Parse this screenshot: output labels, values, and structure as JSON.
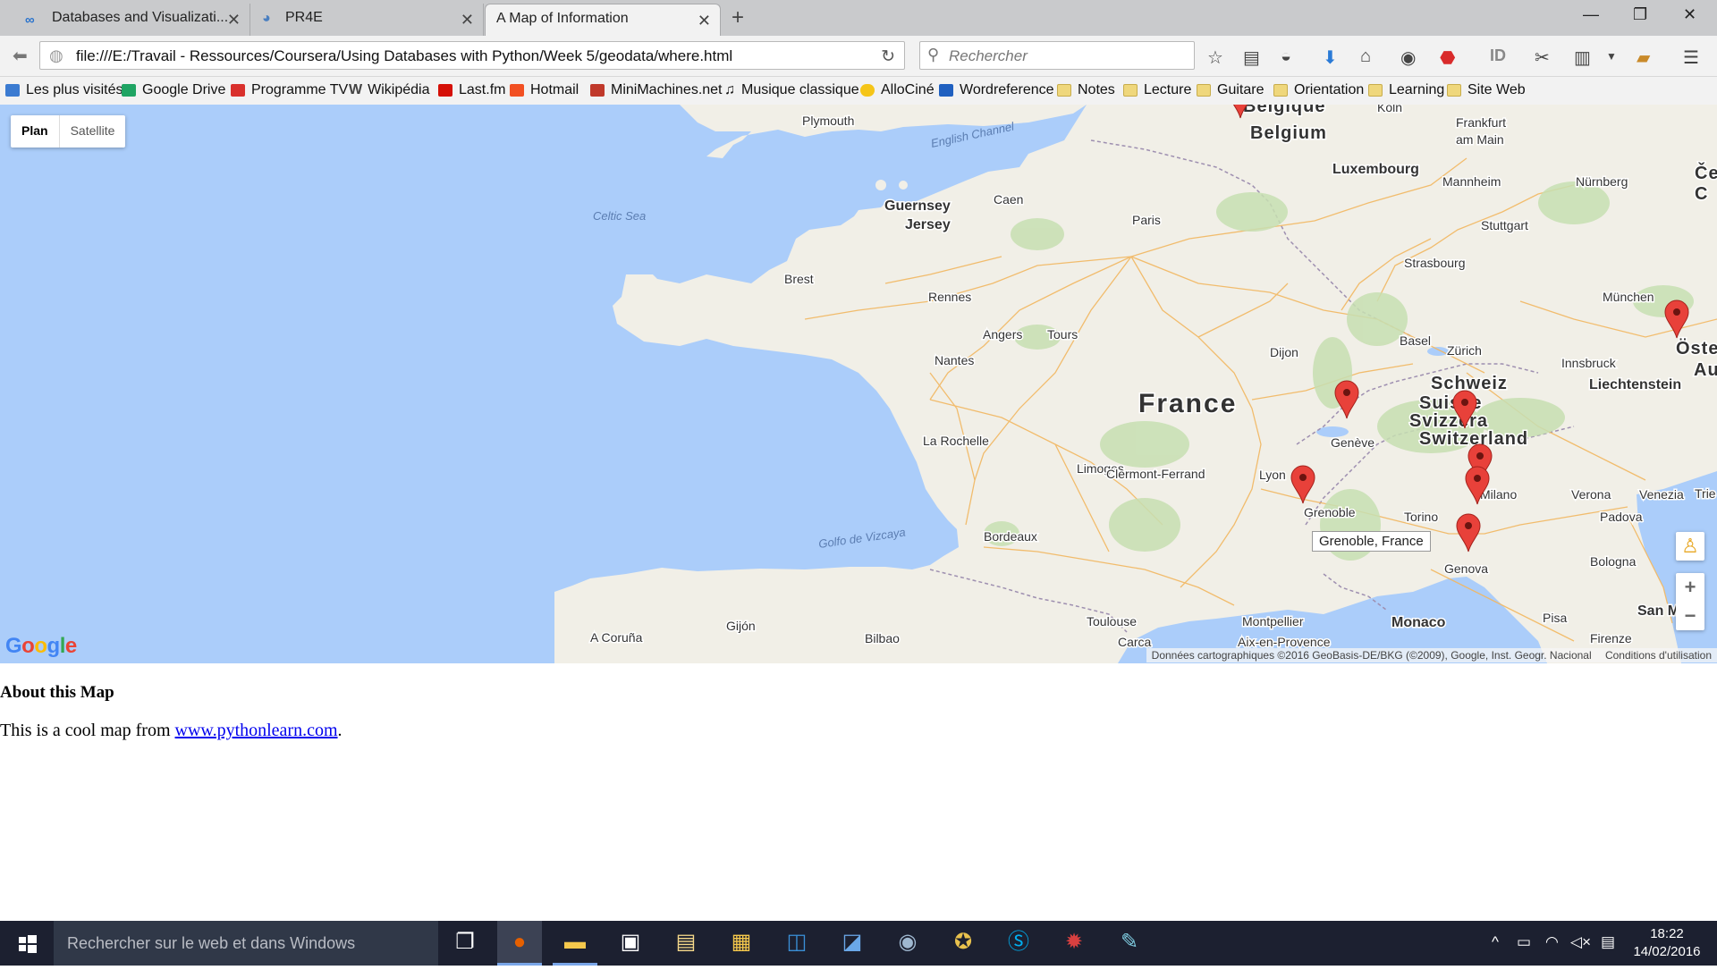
{
  "tabs": [
    {
      "title": "Databases and Visualizati...",
      "icon": "coursera-icon"
    },
    {
      "title": "PR4E",
      "icon": "pr4e-icon"
    },
    {
      "title": "A Map of Information",
      "active": true
    }
  ],
  "navbar": {
    "url": "file:///E:/Travail - Ressources/Coursera/Using Databases with Python/Week 5/geodata/where.html",
    "search_placeholder": "Rechercher"
  },
  "bookmarks": [
    {
      "label": "Les plus visités",
      "icon": "most-visited-icon",
      "color": "#3b7bd1"
    },
    {
      "label": "Google Drive",
      "icon": "google-drive-icon",
      "color": "#1fa463"
    },
    {
      "label": "Programme TV",
      "icon": "programme-tv-icon",
      "color": "#d9302c"
    },
    {
      "label": "Wikipédia",
      "icon": "wikipedia-icon",
      "color": "#555555"
    },
    {
      "label": "Last.fm",
      "icon": "lastfm-icon",
      "color": "#d51007"
    },
    {
      "label": "Hotmail",
      "icon": "hotmail-icon",
      "color": "#f25022"
    },
    {
      "label": "MiniMachines.net",
      "icon": "minimachines-icon",
      "color": "#c0392b"
    },
    {
      "label": "Musique classique",
      "icon": "music-note-icon",
      "color": "#333333"
    },
    {
      "label": "AlloCiné",
      "icon": "allocine-icon",
      "color": "#f5c518"
    },
    {
      "label": "Wordreference",
      "icon": "wordreference-icon",
      "color": "#2060c0"
    },
    {
      "label": "Notes",
      "icon": "folder-icon"
    },
    {
      "label": "Lecture",
      "icon": "folder-icon"
    },
    {
      "label": "Guitare",
      "icon": "folder-icon"
    },
    {
      "label": "Orientation",
      "icon": "folder-icon"
    },
    {
      "label": "Learning",
      "icon": "folder-icon"
    },
    {
      "label": "Site Web",
      "icon": "folder-icon"
    }
  ],
  "map": {
    "type_plan": "Plan",
    "type_satellite": "Satellite",
    "tooltip": "Grenoble, France",
    "attribution": "Données cartographiques ©2016 GeoBasis-DE/BKG (©2009), Google, Inst. Geogr. Nacional",
    "terms": "Conditions d'utilisation",
    "zoom_in": "+",
    "zoom_out": "−",
    "logo": "Google",
    "sea_color": "#abcdfa",
    "land_color": "#f1efe7",
    "marker_color": "#e8413a",
    "labels": [
      {
        "text": "Belgique",
        "kind": "country"
      },
      {
        "text": "Belgium",
        "kind": "country"
      },
      {
        "text": "Plymouth",
        "kind": "city"
      },
      {
        "text": "English Channel",
        "kind": "water"
      },
      {
        "text": "Köln",
        "kind": "city"
      },
      {
        "text": "Frankfurt",
        "kind": "city"
      },
      {
        "text": "am Main",
        "kind": "city"
      },
      {
        "text": "Luxembourg",
        "kind": "capital"
      },
      {
        "text": "Mannheim",
        "kind": "city"
      },
      {
        "text": "Nürnberg",
        "kind": "city"
      },
      {
        "text": "Guernsey",
        "kind": "capital"
      },
      {
        "text": "Jersey",
        "kind": "capital"
      },
      {
        "text": "Caen",
        "kind": "city"
      },
      {
        "text": "Celtic Sea",
        "kind": "water"
      },
      {
        "text": "Paris",
        "kind": "city"
      },
      {
        "text": "Stuttgart",
        "kind": "city"
      },
      {
        "text": "Strasbourg",
        "kind": "city"
      },
      {
        "text": "Brest",
        "kind": "city"
      },
      {
        "text": "Rennes",
        "kind": "city"
      },
      {
        "text": "München",
        "kind": "city"
      },
      {
        "text": "Angers",
        "kind": "city"
      },
      {
        "text": "Tours",
        "kind": "city"
      },
      {
        "text": "Basel",
        "kind": "city"
      },
      {
        "text": "Zürich",
        "kind": "city"
      },
      {
        "text": "Dijon",
        "kind": "city"
      },
      {
        "text": "Nantes",
        "kind": "city"
      },
      {
        "text": "Innsbruck",
        "kind": "city"
      },
      {
        "text": "Schweiz",
        "kind": "country"
      },
      {
        "text": "Liechtenstein",
        "kind": "capital"
      },
      {
        "text": "Suisse",
        "kind": "country"
      },
      {
        "text": "Svizzera",
        "kind": "country"
      },
      {
        "text": "France",
        "kind": "bigcountry"
      },
      {
        "text": "Switzerland",
        "kind": "country"
      },
      {
        "text": "Genève",
        "kind": "city"
      },
      {
        "text": "La Rochelle",
        "kind": "city"
      },
      {
        "text": "Limoges",
        "kind": "city"
      },
      {
        "text": "Clermont-Ferrand",
        "kind": "city"
      },
      {
        "text": "Lyon",
        "kind": "city"
      },
      {
        "text": "Verona",
        "kind": "city"
      },
      {
        "text": "Venezia",
        "kind": "city"
      },
      {
        "text": "Milano",
        "kind": "city"
      },
      {
        "text": "Grenoble",
        "kind": "city"
      },
      {
        "text": "Torino",
        "kind": "city"
      },
      {
        "text": "Padova",
        "kind": "city"
      },
      {
        "text": "Bordeaux",
        "kind": "city"
      },
      {
        "text": "Golfo de Vizcaya",
        "kind": "water"
      },
      {
        "text": "Genova",
        "kind": "city"
      },
      {
        "text": "Bologna",
        "kind": "city"
      },
      {
        "text": "Toulouse",
        "kind": "city"
      },
      {
        "text": "Montpellier",
        "kind": "city"
      },
      {
        "text": "Monaco",
        "kind": "capital"
      },
      {
        "text": "Pisa",
        "kind": "city"
      },
      {
        "text": "San Mari",
        "kind": "capital"
      },
      {
        "text": "Gijón",
        "kind": "city"
      },
      {
        "text": "A Coruña",
        "kind": "city"
      },
      {
        "text": "Bilbao",
        "kind": "city"
      },
      {
        "text": "Carca",
        "kind": "city"
      },
      {
        "text": "Aix-en-Provence",
        "kind": "city"
      },
      {
        "text": "Firenze",
        "kind": "city"
      },
      {
        "text": "Če",
        "kind": "country"
      },
      {
        "text": "C",
        "kind": "country"
      },
      {
        "text": "Öste",
        "kind": "country"
      },
      {
        "text": "Au",
        "kind": "country"
      },
      {
        "text": "Trie",
        "kind": "city"
      }
    ]
  },
  "page": {
    "heading": "About this Map",
    "text_before": "This is a cool map from ",
    "link": "www.pythonlearn.com",
    "text_after": "."
  },
  "taskbar": {
    "search_placeholder": "Rechercher sur le web et dans Windows",
    "apps": [
      {
        "icon": "task-view-icon",
        "glyph": "❐"
      },
      {
        "icon": "firefox-icon",
        "glyph": "●",
        "color": "#e66000"
      },
      {
        "icon": "file-explorer-icon",
        "glyph": "▬",
        "color": "#f5c84c"
      },
      {
        "icon": "store-icon",
        "glyph": "▣",
        "color": "#ffffff"
      },
      {
        "icon": "documents-icon",
        "glyph": "▤",
        "color": "#f5d88a"
      },
      {
        "icon": "folder-icon",
        "glyph": "▦",
        "color": "#f5c84c"
      },
      {
        "icon": "outlook-icon",
        "glyph": "◫",
        "color": "#3a8fd6"
      },
      {
        "icon": "remote-desktop-icon",
        "glyph": "◪",
        "color": "#6aa8e8"
      },
      {
        "icon": "steam-icon",
        "glyph": "◉",
        "color": "#9fb8d0"
      },
      {
        "icon": "game-app-icon",
        "glyph": "✪",
        "color": "#e8c14d"
      },
      {
        "icon": "skype-icon",
        "glyph": "Ⓢ",
        "color": "#00aff0"
      },
      {
        "icon": "aperture-app-icon",
        "glyph": "✹",
        "color": "#d84040"
      },
      {
        "icon": "paint-app-icon",
        "glyph": "✎",
        "color": "#7fcce0"
      }
    ],
    "time": "18:22",
    "date": "14/02/2016"
  }
}
